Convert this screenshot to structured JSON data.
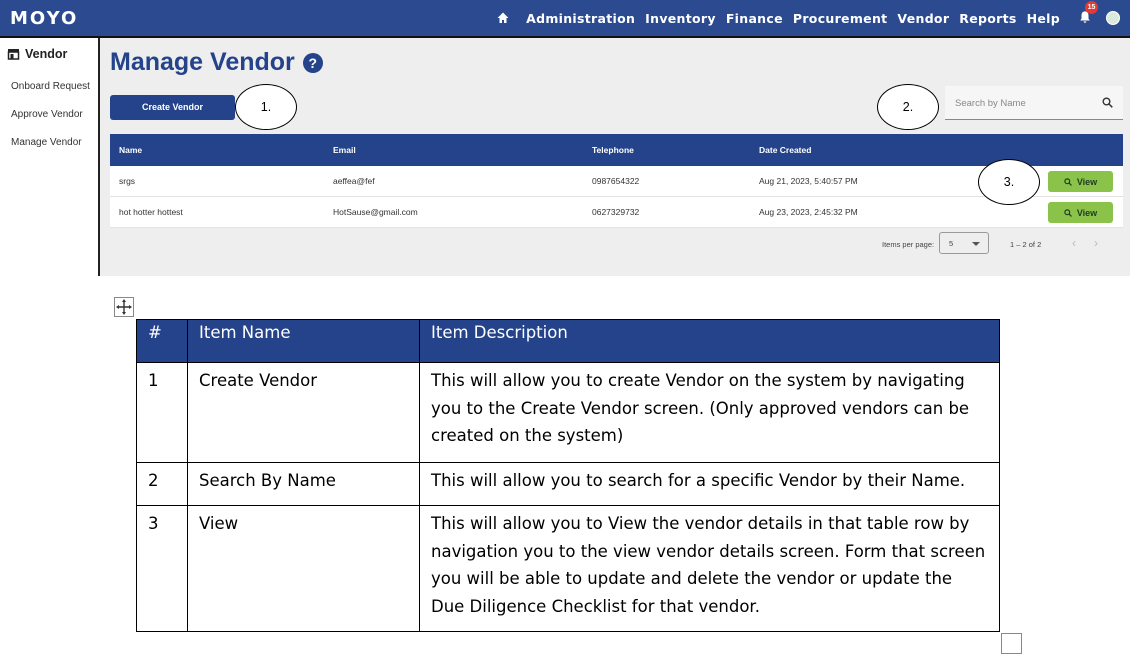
{
  "topbar": {
    "logo": "MOYO",
    "nav": [
      "Administration",
      "Inventory",
      "Finance",
      "Procurement",
      "Vendor",
      "Reports",
      "Help"
    ],
    "notification_count": "15"
  },
  "sidebar": {
    "title": "Vendor",
    "items": [
      "Onboard Request",
      "Approve Vendor",
      "Manage Vendor"
    ]
  },
  "main": {
    "title": "Manage Vendor",
    "help_glyph": "?",
    "create_button": "Create Vendor",
    "search_placeholder": "Search by Name",
    "callouts": [
      "1.",
      "2.",
      "3."
    ],
    "table": {
      "headers": [
        "Name",
        "Email",
        "Telephone",
        "Date Created"
      ],
      "rows": [
        {
          "name": "srgs",
          "email": "aeffea@fef",
          "telephone": "0987654322",
          "date": "Aug 21, 2023, 5:40:57 PM",
          "action": "View"
        },
        {
          "name": "hot hotter hottest",
          "email": "HotSause@gmail.com",
          "telephone": "0627329732",
          "date": "Aug 23, 2023, 2:45:32 PM",
          "action": "View"
        }
      ]
    },
    "pager": {
      "items_per_page_label": "Items per page:",
      "items_per_page": "5",
      "range": "1 – 2 of 2"
    }
  },
  "doc_table": {
    "headers": [
      "#",
      "Item Name",
      "Item Description"
    ],
    "rows": [
      {
        "num": "1",
        "name": "Create Vendor",
        "desc": "This will allow you to create Vendor on the system by navigating you to the Create Vendor screen. (Only approved vendors can be created on the system)"
      },
      {
        "num": "2",
        "name": "Search By Name",
        "desc": "This will allow you to search for a specific Vendor by their Name."
      },
      {
        "num": "3",
        "name": "View",
        "desc": "This will allow you to View the vendor details in that table row by navigation you to the view vendor details screen. Form that screen you will be able to update and delete the vendor or update the Due Diligence Checklist for that vendor."
      }
    ]
  }
}
